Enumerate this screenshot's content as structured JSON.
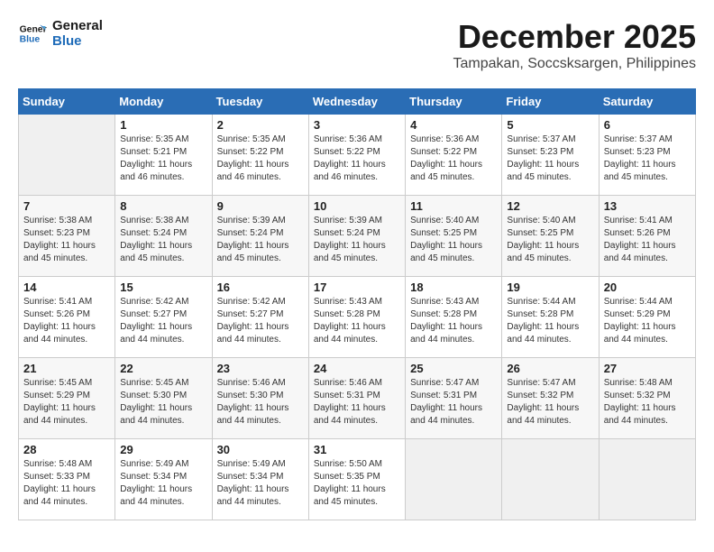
{
  "logo": {
    "line1": "General",
    "line2": "Blue"
  },
  "title": "December 2025",
  "location": "Tampakan, Soccsksargen, Philippines",
  "weekdays": [
    "Sunday",
    "Monday",
    "Tuesday",
    "Wednesday",
    "Thursday",
    "Friday",
    "Saturday"
  ],
  "weeks": [
    [
      {
        "day": "",
        "sunrise": "",
        "sunset": "",
        "daylight": ""
      },
      {
        "day": "1",
        "sunrise": "Sunrise: 5:35 AM",
        "sunset": "Sunset: 5:21 PM",
        "daylight": "Daylight: 11 hours and 46 minutes."
      },
      {
        "day": "2",
        "sunrise": "Sunrise: 5:35 AM",
        "sunset": "Sunset: 5:22 PM",
        "daylight": "Daylight: 11 hours and 46 minutes."
      },
      {
        "day": "3",
        "sunrise": "Sunrise: 5:36 AM",
        "sunset": "Sunset: 5:22 PM",
        "daylight": "Daylight: 11 hours and 46 minutes."
      },
      {
        "day": "4",
        "sunrise": "Sunrise: 5:36 AM",
        "sunset": "Sunset: 5:22 PM",
        "daylight": "Daylight: 11 hours and 45 minutes."
      },
      {
        "day": "5",
        "sunrise": "Sunrise: 5:37 AM",
        "sunset": "Sunset: 5:23 PM",
        "daylight": "Daylight: 11 hours and 45 minutes."
      },
      {
        "day": "6",
        "sunrise": "Sunrise: 5:37 AM",
        "sunset": "Sunset: 5:23 PM",
        "daylight": "Daylight: 11 hours and 45 minutes."
      }
    ],
    [
      {
        "day": "7",
        "sunrise": "Sunrise: 5:38 AM",
        "sunset": "Sunset: 5:23 PM",
        "daylight": "Daylight: 11 hours and 45 minutes."
      },
      {
        "day": "8",
        "sunrise": "Sunrise: 5:38 AM",
        "sunset": "Sunset: 5:24 PM",
        "daylight": "Daylight: 11 hours and 45 minutes."
      },
      {
        "day": "9",
        "sunrise": "Sunrise: 5:39 AM",
        "sunset": "Sunset: 5:24 PM",
        "daylight": "Daylight: 11 hours and 45 minutes."
      },
      {
        "day": "10",
        "sunrise": "Sunrise: 5:39 AM",
        "sunset": "Sunset: 5:24 PM",
        "daylight": "Daylight: 11 hours and 45 minutes."
      },
      {
        "day": "11",
        "sunrise": "Sunrise: 5:40 AM",
        "sunset": "Sunset: 5:25 PM",
        "daylight": "Daylight: 11 hours and 45 minutes."
      },
      {
        "day": "12",
        "sunrise": "Sunrise: 5:40 AM",
        "sunset": "Sunset: 5:25 PM",
        "daylight": "Daylight: 11 hours and 45 minutes."
      },
      {
        "day": "13",
        "sunrise": "Sunrise: 5:41 AM",
        "sunset": "Sunset: 5:26 PM",
        "daylight": "Daylight: 11 hours and 44 minutes."
      }
    ],
    [
      {
        "day": "14",
        "sunrise": "Sunrise: 5:41 AM",
        "sunset": "Sunset: 5:26 PM",
        "daylight": "Daylight: 11 hours and 44 minutes."
      },
      {
        "day": "15",
        "sunrise": "Sunrise: 5:42 AM",
        "sunset": "Sunset: 5:27 PM",
        "daylight": "Daylight: 11 hours and 44 minutes."
      },
      {
        "day": "16",
        "sunrise": "Sunrise: 5:42 AM",
        "sunset": "Sunset: 5:27 PM",
        "daylight": "Daylight: 11 hours and 44 minutes."
      },
      {
        "day": "17",
        "sunrise": "Sunrise: 5:43 AM",
        "sunset": "Sunset: 5:28 PM",
        "daylight": "Daylight: 11 hours and 44 minutes."
      },
      {
        "day": "18",
        "sunrise": "Sunrise: 5:43 AM",
        "sunset": "Sunset: 5:28 PM",
        "daylight": "Daylight: 11 hours and 44 minutes."
      },
      {
        "day": "19",
        "sunrise": "Sunrise: 5:44 AM",
        "sunset": "Sunset: 5:28 PM",
        "daylight": "Daylight: 11 hours and 44 minutes."
      },
      {
        "day": "20",
        "sunrise": "Sunrise: 5:44 AM",
        "sunset": "Sunset: 5:29 PM",
        "daylight": "Daylight: 11 hours and 44 minutes."
      }
    ],
    [
      {
        "day": "21",
        "sunrise": "Sunrise: 5:45 AM",
        "sunset": "Sunset: 5:29 PM",
        "daylight": "Daylight: 11 hours and 44 minutes."
      },
      {
        "day": "22",
        "sunrise": "Sunrise: 5:45 AM",
        "sunset": "Sunset: 5:30 PM",
        "daylight": "Daylight: 11 hours and 44 minutes."
      },
      {
        "day": "23",
        "sunrise": "Sunrise: 5:46 AM",
        "sunset": "Sunset: 5:30 PM",
        "daylight": "Daylight: 11 hours and 44 minutes."
      },
      {
        "day": "24",
        "sunrise": "Sunrise: 5:46 AM",
        "sunset": "Sunset: 5:31 PM",
        "daylight": "Daylight: 11 hours and 44 minutes."
      },
      {
        "day": "25",
        "sunrise": "Sunrise: 5:47 AM",
        "sunset": "Sunset: 5:31 PM",
        "daylight": "Daylight: 11 hours and 44 minutes."
      },
      {
        "day": "26",
        "sunrise": "Sunrise: 5:47 AM",
        "sunset": "Sunset: 5:32 PM",
        "daylight": "Daylight: 11 hours and 44 minutes."
      },
      {
        "day": "27",
        "sunrise": "Sunrise: 5:48 AM",
        "sunset": "Sunset: 5:32 PM",
        "daylight": "Daylight: 11 hours and 44 minutes."
      }
    ],
    [
      {
        "day": "28",
        "sunrise": "Sunrise: 5:48 AM",
        "sunset": "Sunset: 5:33 PM",
        "daylight": "Daylight: 11 hours and 44 minutes."
      },
      {
        "day": "29",
        "sunrise": "Sunrise: 5:49 AM",
        "sunset": "Sunset: 5:34 PM",
        "daylight": "Daylight: 11 hours and 44 minutes."
      },
      {
        "day": "30",
        "sunrise": "Sunrise: 5:49 AM",
        "sunset": "Sunset: 5:34 PM",
        "daylight": "Daylight: 11 hours and 44 minutes."
      },
      {
        "day": "31",
        "sunrise": "Sunrise: 5:50 AM",
        "sunset": "Sunset: 5:35 PM",
        "daylight": "Daylight: 11 hours and 45 minutes."
      },
      {
        "day": "",
        "sunrise": "",
        "sunset": "",
        "daylight": ""
      },
      {
        "day": "",
        "sunrise": "",
        "sunset": "",
        "daylight": ""
      },
      {
        "day": "",
        "sunrise": "",
        "sunset": "",
        "daylight": ""
      }
    ]
  ]
}
